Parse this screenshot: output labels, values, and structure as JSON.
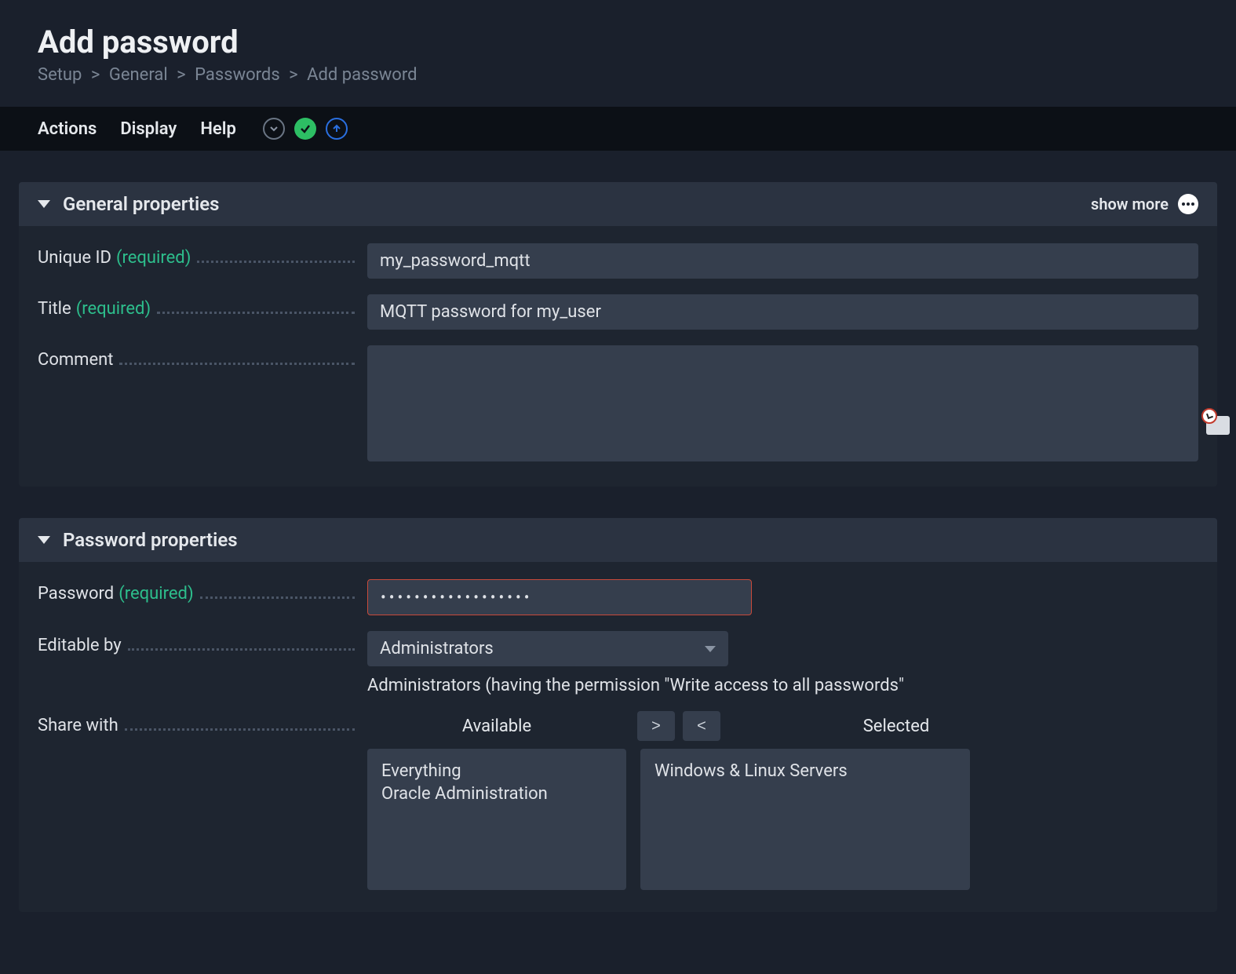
{
  "page": {
    "title": "Add password"
  },
  "breadcrumb": {
    "items": [
      "Setup",
      "General",
      "Passwords",
      "Add password"
    ]
  },
  "toolbar": {
    "actions": "Actions",
    "display": "Display",
    "help": "Help"
  },
  "panels": {
    "general": {
      "title": "General properties",
      "show_more": "show more",
      "unique_id": {
        "label": "Unique ID",
        "required": "(required)",
        "value": "my_password_mqtt"
      },
      "title_field": {
        "label": "Title",
        "required": "(required)",
        "value": "MQTT password for my_user"
      },
      "comment": {
        "label": "Comment",
        "value": ""
      }
    },
    "password": {
      "title": "Password properties",
      "password_field": {
        "label": "Password",
        "required": "(required)",
        "value": "aaaaaaaaaaaaaaaaaa"
      },
      "editable_by": {
        "label": "Editable by",
        "value": "Administrators",
        "hint": "Administrators (having the permission \"Write access to all passwords\""
      },
      "share_with": {
        "label": "Share with",
        "available_header": "Available",
        "selected_header": "Selected",
        "move_right": ">",
        "move_left": "<",
        "available": [
          "Everything",
          "Oracle Administration"
        ],
        "selected": [
          "Windows & Linux Servers"
        ]
      }
    }
  }
}
